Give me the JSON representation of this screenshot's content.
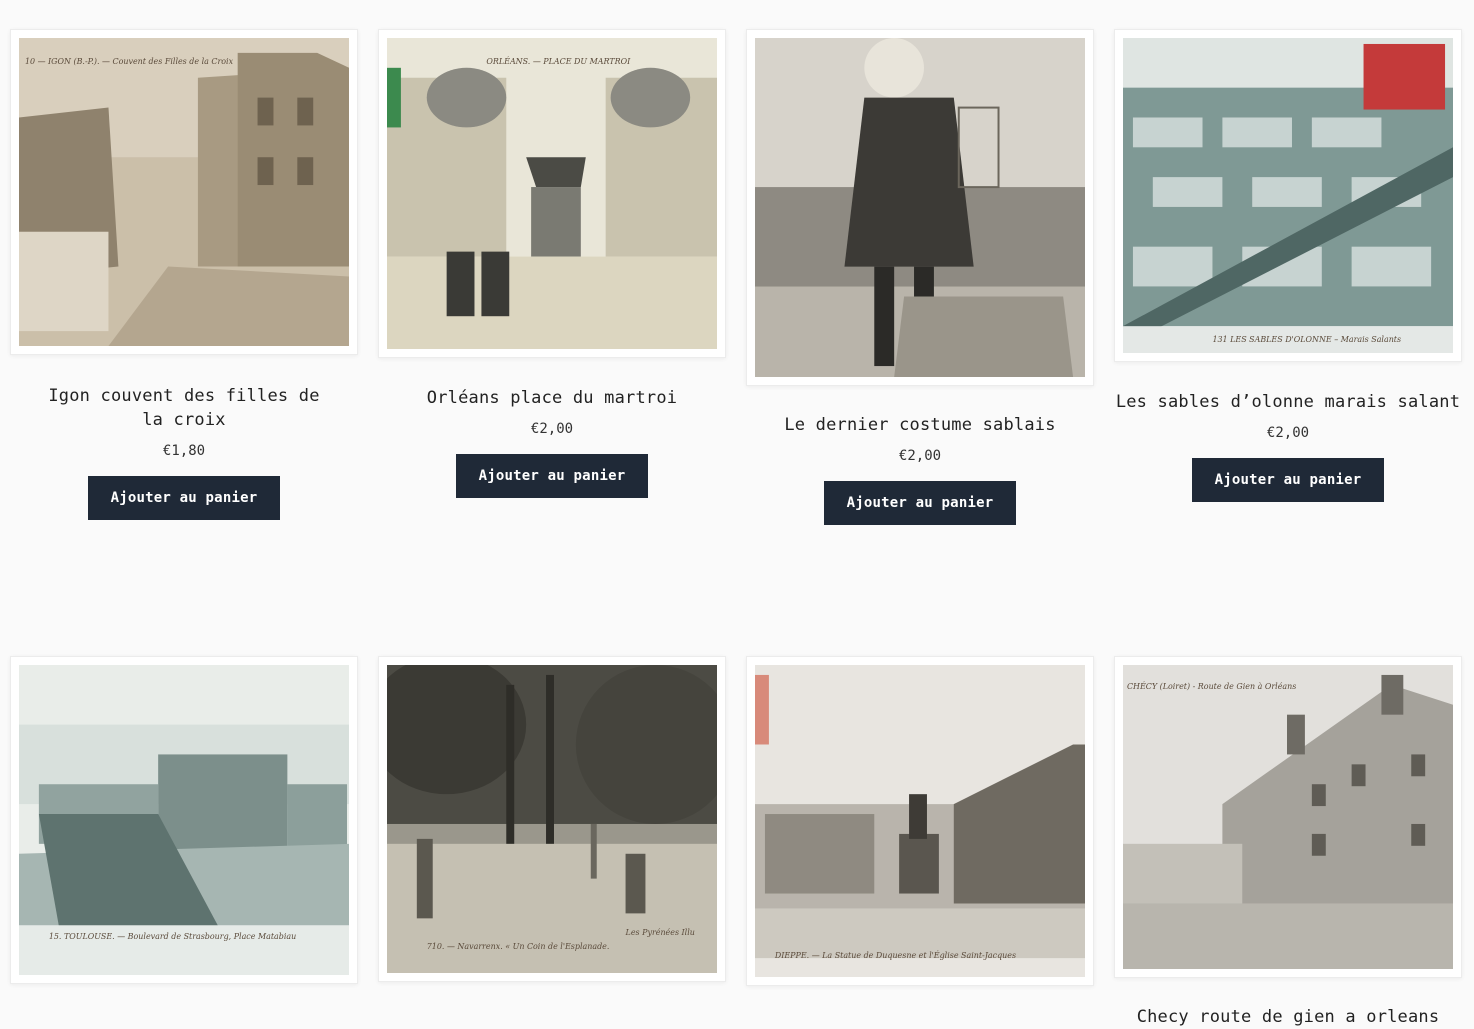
{
  "products": [
    {
      "title": "Igon couvent des filles de la croix",
      "price": "€1,80",
      "button": "Ajouter au panier",
      "photo_caption": "10 — IGON (B.-P.). — Couvent des Filles de la Croix"
    },
    {
      "title": "Orléans place du martroi",
      "price": "€2,00",
      "button": "Ajouter au panier",
      "photo_caption": "ORLÉANS. — PLACE DU MARTROI"
    },
    {
      "title": "Le dernier costume sablais",
      "price": "€2,00",
      "button": "Ajouter au panier",
      "photo_caption": ""
    },
    {
      "title": "Les sables d’olonne marais salant",
      "price": "€2,00",
      "button": "Ajouter au panier",
      "photo_caption": "131 LES SABLES D'OLONNE – Marais Salants"
    },
    {
      "title": "",
      "photo_caption": "15. TOULOUSE. — Boulevard de Strasbourg, Place Matabiau"
    },
    {
      "title": "",
      "photo_caption": "710. — Navarrenx. « Un Coin de l'Esplanade.",
      "photo_caption2": "Les Pyrénées Illu"
    },
    {
      "title": "",
      "photo_caption": "DIEPPE. — La Statue de Duquesne et l'Église Saint-Jacques"
    },
    {
      "title": "Checy route de gien a orleans",
      "photo_caption": "CHÉCY (Loiret) - Route de Gien à Orléans"
    }
  ],
  "colors": {
    "button_bg": "#1f2937",
    "button_text": "#ffffff",
    "page_bg": "#fafafa"
  }
}
